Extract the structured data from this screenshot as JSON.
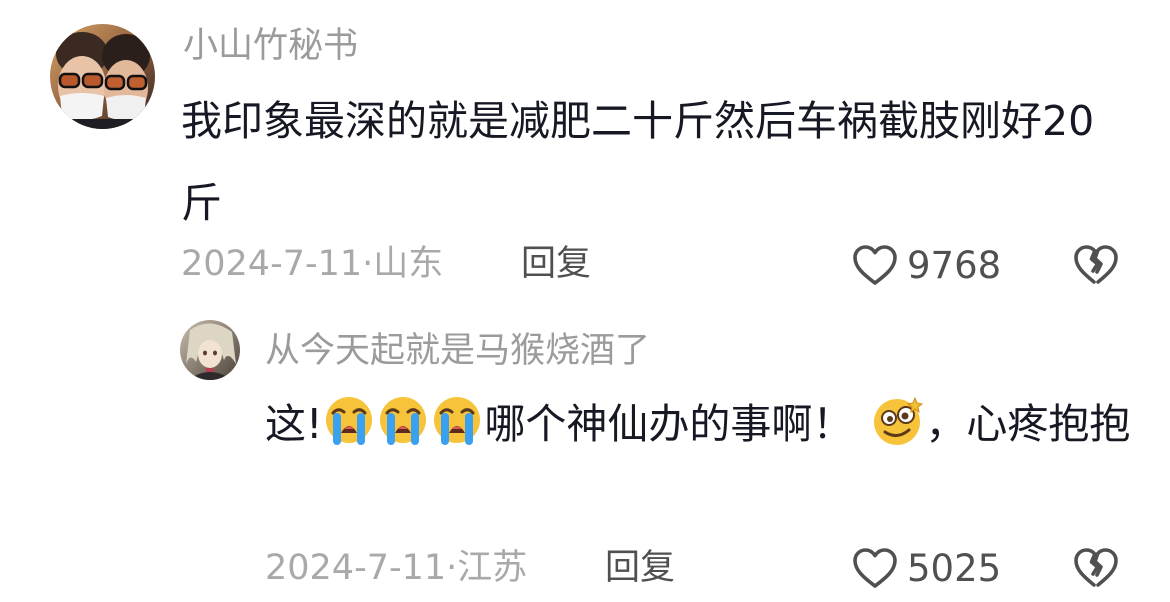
{
  "comments": [
    {
      "username": "小山竹秘书",
      "text": "我印象最深的就是减肥二十斤然后车祸截肢刚好20斤",
      "date": "2024-7-11",
      "location": "山东",
      "reply_label": "回复",
      "likes": "9768"
    },
    {
      "username": "从今天起就是马猴烧酒了",
      "text_before": "这!",
      "emoji_crying": "loudly-crying-face-emoji",
      "text_middle": "哪个神仙办的事啊！",
      "emoji_woozy": "woozy-face-emoji",
      "text_after": "，心疼抱抱",
      "date": "2024-7-11",
      "location": "江苏",
      "reply_label": "回复",
      "likes": "5025"
    }
  ],
  "separator": "·",
  "colors": {
    "username": "#9b9b9b",
    "content": "#161823",
    "meta": "#a9a9a9",
    "action": "#505050"
  },
  "icons": {
    "like": "heart-outline-icon",
    "dislike": "broken-heart-icon"
  }
}
